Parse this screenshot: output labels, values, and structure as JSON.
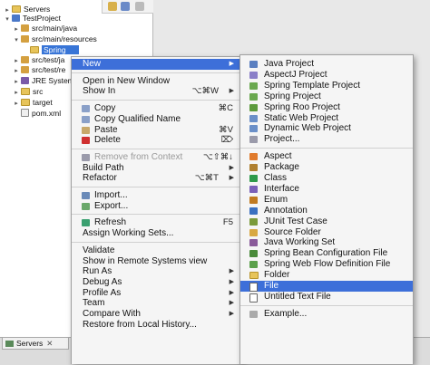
{
  "explorer": {
    "tree": [
      {
        "label": "Servers",
        "twisty": "▸",
        "icon": "folder",
        "indent": 0
      },
      {
        "label": "TestProject",
        "twisty": "▾",
        "icon": "project",
        "indent": 0
      },
      {
        "label": "src/main/java",
        "twisty": "▸",
        "icon": "src",
        "indent": 1
      },
      {
        "label": "src/main/resources",
        "twisty": "▾",
        "icon": "src",
        "indent": 1
      },
      {
        "label": "Spring",
        "twisty": "",
        "icon": "folder",
        "indent": 2,
        "selected": true
      },
      {
        "label": "src/test/ja",
        "twisty": "▸",
        "icon": "src",
        "indent": 1
      },
      {
        "label": "src/test/re",
        "twisty": "▸",
        "icon": "src",
        "indent": 1
      },
      {
        "label": "JRE System",
        "twisty": "▸",
        "icon": "lib",
        "indent": 1
      },
      {
        "label": "src",
        "twisty": "▸",
        "icon": "folder",
        "indent": 1
      },
      {
        "label": "target",
        "twisty": "▸",
        "icon": "folder",
        "indent": 1
      },
      {
        "label": "pom.xml",
        "twisty": "",
        "icon": "xml",
        "indent": 1
      }
    ]
  },
  "servers_view": {
    "tab_label": "Servers",
    "close": "✕"
  },
  "context_menu": {
    "items": [
      {
        "label": "New",
        "arrow": "▶",
        "highlight": true
      },
      {
        "sep": true
      },
      {
        "label": "Open in New Window"
      },
      {
        "label": "Show In",
        "shortcut": "⌥⌘W",
        "arrow": "▶"
      },
      {
        "sep": true
      },
      {
        "label": "Copy",
        "icon": "copy",
        "shortcut": "⌘C"
      },
      {
        "label": "Copy Qualified Name",
        "icon": "copy"
      },
      {
        "label": "Paste",
        "icon": "paste",
        "shortcut": "⌘V"
      },
      {
        "label": "Delete",
        "icon": "delete",
        "shortcut": "⌦"
      },
      {
        "sep": true
      },
      {
        "label": "Remove from Context",
        "icon": "proj",
        "shortcut": "⌥⇧⌘↓",
        "disabled": true
      },
      {
        "label": "Build Path",
        "arrow": "▶"
      },
      {
        "label": "Refactor",
        "shortcut": "⌥⌘T",
        "arrow": "▶"
      },
      {
        "sep": true
      },
      {
        "label": "Import...",
        "icon": "import"
      },
      {
        "label": "Export...",
        "icon": "export"
      },
      {
        "sep": true
      },
      {
        "label": "Refresh",
        "icon": "refresh",
        "shortcut": "F5"
      },
      {
        "label": "Assign Working Sets..."
      },
      {
        "sep": true
      },
      {
        "label": "Validate"
      },
      {
        "label": "Show in Remote Systems view"
      },
      {
        "label": "Run As",
        "arrow": "▶"
      },
      {
        "label": "Debug As",
        "arrow": "▶"
      },
      {
        "label": "Profile As",
        "arrow": "▶"
      },
      {
        "label": "Team",
        "arrow": "▶"
      },
      {
        "label": "Compare With",
        "arrow": "▶"
      },
      {
        "label": "Restore from Local History..."
      }
    ]
  },
  "new_submenu": {
    "items": [
      {
        "label": "Java Project",
        "icon": "java"
      },
      {
        "label": "AspectJ Project",
        "icon": "aspectj"
      },
      {
        "label": "Spring Template Project",
        "icon": "spring"
      },
      {
        "label": "Spring Project",
        "icon": "spring"
      },
      {
        "label": "Spring Roo Project",
        "icon": "roo"
      },
      {
        "label": "Static Web Project",
        "icon": "web"
      },
      {
        "label": "Dynamic Web Project",
        "icon": "web"
      },
      {
        "label": "Project...",
        "icon": "proj"
      },
      {
        "sep": true
      },
      {
        "label": "Aspect",
        "icon": "aspect"
      },
      {
        "label": "Package",
        "icon": "pkg"
      },
      {
        "label": "Class",
        "icon": "class"
      },
      {
        "label": "Interface",
        "icon": "iface"
      },
      {
        "label": "Enum",
        "icon": "enum"
      },
      {
        "label": "Annotation",
        "icon": "annot"
      },
      {
        "label": "JUnit Test Case",
        "icon": "junit"
      },
      {
        "label": "Source Folder",
        "icon": "srcf"
      },
      {
        "label": "Java Working Set",
        "icon": "jws"
      },
      {
        "label": "Spring Bean Configuration File",
        "icon": "bean"
      },
      {
        "label": "Spring Web Flow Definition File",
        "icon": "flow"
      },
      {
        "label": "Folder",
        "icon": "folder"
      },
      {
        "label": "File",
        "icon": "file",
        "highlight": true
      },
      {
        "label": "Untitled Text File",
        "icon": "text"
      },
      {
        "sep": true
      },
      {
        "label": "Example...",
        "icon": "example"
      }
    ]
  }
}
